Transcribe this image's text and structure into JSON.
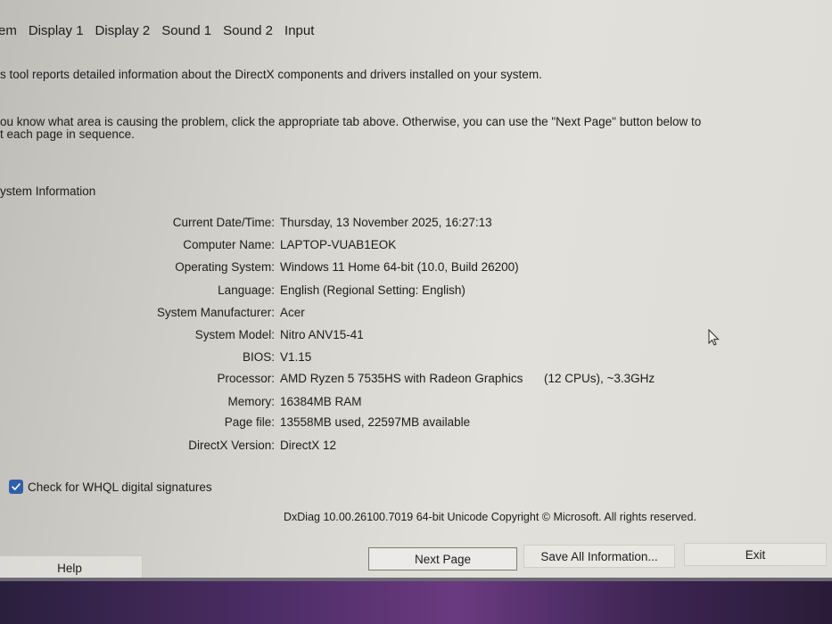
{
  "tabs": [
    "em",
    "Display 1",
    "Display 2",
    "Sound 1",
    "Sound 2",
    "Input"
  ],
  "intro": {
    "line1": "s tool reports detailed information about the DirectX components and drivers installed on your system.",
    "line2": "ou know what area is causing the problem, click the appropriate tab above.  Otherwise, you can use the \"Next Page\" button below to",
    "line3": "t each page in sequence."
  },
  "section_title": "ystem Information",
  "info": [
    {
      "label": "Current Date/Time:",
      "value": "Thursday, 13 November 2025, 16:27:13"
    },
    {
      "label": "Computer Name:",
      "value": "LAPTOP-VUAB1EOK"
    },
    {
      "label": "Operating System:",
      "value": "Windows 11 Home 64-bit (10.0, Build 26200)"
    },
    {
      "label": "Language:",
      "value": "English (Regional Setting: English)"
    },
    {
      "label": "System Manufacturer:",
      "value": "Acer"
    },
    {
      "label": "System Model:",
      "value": "Nitro ANV15-41"
    },
    {
      "label": "BIOS:",
      "value": "V1.15"
    },
    {
      "label": "Processor:",
      "value": "AMD Ryzen 5 7535HS with Radeon Graphics",
      "extra": "(12 CPUs), ~3.3GHz"
    },
    {
      "label": "Memory:",
      "value": "16384MB RAM"
    },
    {
      "label": "Page file:",
      "value": "13558MB used, 22597MB available"
    },
    {
      "label": "DirectX Version:",
      "value": "DirectX 12"
    }
  ],
  "whql": {
    "label": "Check for WHQL digital signatures",
    "checked": true
  },
  "footer": "DxDiag 10.00.26100.7019 64-bit Unicode  Copyright © Microsoft. All rights reserved.",
  "buttons": {
    "help": "Help",
    "next": "Next Page",
    "save": "Save All Information...",
    "exit": "Exit"
  },
  "colors": {
    "checkbox": "#2f5fa8",
    "background": "#dedcd6"
  }
}
